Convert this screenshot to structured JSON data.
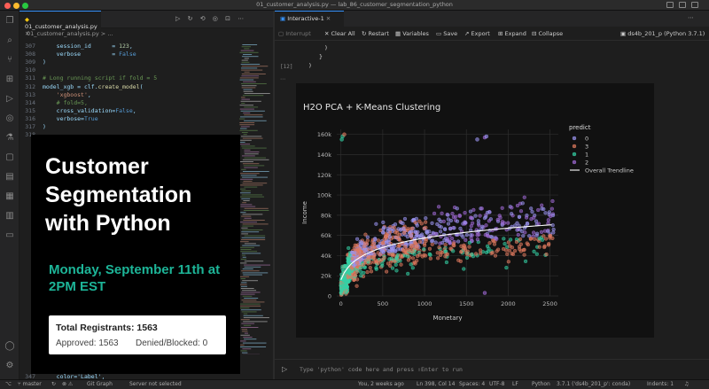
{
  "window": {
    "title": "01_customer_analysis.py — lab_86_customer_segmentation_python"
  },
  "editor": {
    "tab_label": "01_customer_analysis.py",
    "breadcrumb": "01_customer_analysis.py > ...",
    "lines": [
      {
        "num": "307",
        "text": "    session_id      = 123,"
      },
      {
        "num": "308",
        "text": "    verbose         = False"
      },
      {
        "num": "309",
        "text": ")"
      },
      {
        "num": "310",
        "text": ""
      },
      {
        "num": "311",
        "text": "# Long running script if fold = 5"
      },
      {
        "num": "312",
        "text": "model_xgb = clf.create_model("
      },
      {
        "num": "313",
        "text": "    'xgboost',"
      },
      {
        "num": "314",
        "text": "    # fold=5,"
      },
      {
        "num": "315",
        "text": "    cross_validation=False,"
      },
      {
        "num": "316",
        "text": "    verbose=True"
      },
      {
        "num": "317",
        "text": ")"
      },
      {
        "num": "318",
        "text": ""
      }
    ],
    "bottom_line_num": "347",
    "bottom_line_text": "    color='Label',"
  },
  "promo": {
    "title": "Customer Segmentation with Python",
    "date": "Monday, September 11th at 2PM EST",
    "total_label": "Total Registrants: 1563",
    "approved_label": "Approved: 1563",
    "denied_label": "Denied/Blocked: 0"
  },
  "interactive": {
    "tab_label": "Interactive-1",
    "toolbar": {
      "interrupt": "Interrupt",
      "clear_all": "Clear All",
      "restart": "Restart",
      "variables": "Variables",
      "save": "Save",
      "export": "Export",
      "expand": "Expand",
      "collapse": "Collapse",
      "kernel": "ds4b_201_p (Python 3.7.1)"
    },
    "cell_number": "[12]",
    "input_placeholder": "Type 'python' code here and press ⇧Enter to run"
  },
  "chart_data": {
    "type": "scatter",
    "title": "H2O PCA + K-Means Clustering",
    "xlabel": "Monetary",
    "ylabel": "Income",
    "xlim": [
      -50,
      2600
    ],
    "ylim": [
      0,
      165000
    ],
    "x_ticks": [
      0,
      500,
      1000,
      1500,
      2000,
      2500
    ],
    "y_ticks": [
      0,
      20000,
      40000,
      60000,
      80000,
      100000,
      120000,
      140000,
      160000
    ],
    "y_tick_labels": [
      "0",
      "20k",
      "40k",
      "60k",
      "80k",
      "100k",
      "120k",
      "140k",
      "160k"
    ],
    "legend_title": "predict",
    "legend_position": "top-right",
    "grid": true,
    "series": [
      {
        "name": "0",
        "color": "#9b94f0"
      },
      {
        "name": "3",
        "color": "#e07a5f"
      },
      {
        "name": "1",
        "color": "#34d1a5"
      },
      {
        "name": "2",
        "color": "#a06ad6"
      }
    ],
    "trendline": {
      "name": "Overall Trendline",
      "color": "#ffffff"
    },
    "outliers": [
      {
        "x": 10,
        "y": 155000,
        "series": "1"
      },
      {
        "x": 20,
        "y": 158000,
        "series": "1"
      },
      {
        "x": 40,
        "y": 160000,
        "series": "3"
      },
      {
        "x": 1630,
        "y": 155000,
        "series": "0"
      },
      {
        "x": 1720,
        "y": 157000,
        "series": "2"
      },
      {
        "x": 1740,
        "y": 158000,
        "series": "0"
      },
      {
        "x": 1720,
        "y": 3000,
        "series": "2"
      }
    ]
  },
  "status": {
    "branch": "master",
    "git_graph": "Git Graph",
    "server": "Server not selected",
    "blame": "You, 2 weeks ago",
    "position": "Ln 398, Col 14",
    "spaces": "Spaces: 4",
    "encoding": "UTF-8",
    "eol": "LF",
    "language": "Python",
    "interpreter": "3.7.1 ('ds4b_201_p': conda)",
    "indent": "Indents: 1"
  }
}
